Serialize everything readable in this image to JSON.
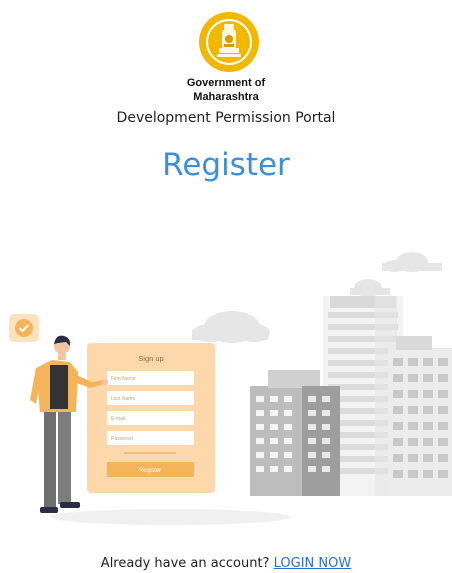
{
  "header": {
    "gov_line1": "Government of",
    "gov_line2": "Maharashtra",
    "portal_name": "Development Permission Portal"
  },
  "page": {
    "title": "Register"
  },
  "illustration": {
    "form_title": "Sign up",
    "fields": [
      "First Name",
      "Last Name",
      "E-mail",
      "Password"
    ],
    "button": "Register",
    "accent": "#f6b45a"
  },
  "footer": {
    "prompt": "Already have an account?",
    "login_link": "LOGIN NOW"
  },
  "colors": {
    "title": "#3d8fd8",
    "link": "#2b6fd6",
    "emblem": "#f2b800"
  }
}
